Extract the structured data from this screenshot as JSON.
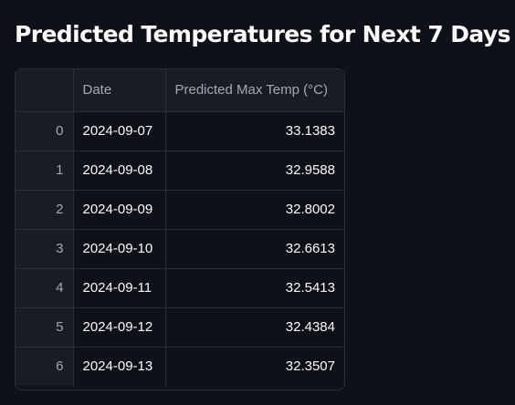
{
  "page": {
    "title": "Predicted Temperatures for Next 7 Days"
  },
  "table": {
    "columns": [
      "",
      "Date",
      "Predicted Max Temp (°C)"
    ],
    "rows": [
      {
        "index": "0",
        "date": "2024-09-07",
        "temp": "33.1383"
      },
      {
        "index": "1",
        "date": "2024-09-08",
        "temp": "32.9588"
      },
      {
        "index": "2",
        "date": "2024-09-09",
        "temp": "32.8002"
      },
      {
        "index": "3",
        "date": "2024-09-10",
        "temp": "32.6613"
      },
      {
        "index": "4",
        "date": "2024-09-11",
        "temp": "32.5413"
      },
      {
        "index": "5",
        "date": "2024-09-12",
        "temp": "32.4384"
      },
      {
        "index": "6",
        "date": "2024-09-13",
        "temp": "32.3507"
      }
    ]
  },
  "colors": {
    "background": "#0e1117",
    "header_background": "#1a1c24",
    "border": "#2b2e36",
    "text": "#fafafa",
    "muted_text": "#a3a8b8"
  }
}
